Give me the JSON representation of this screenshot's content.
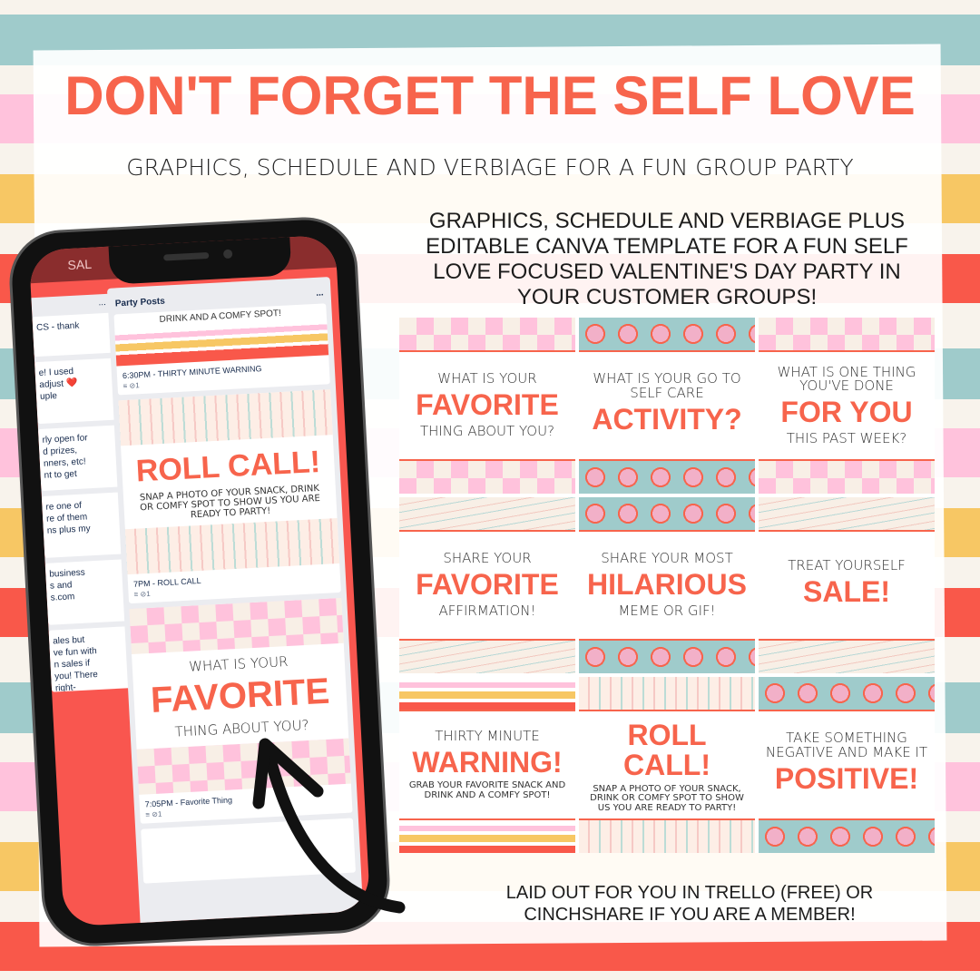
{
  "title": "DON'T FORGET THE SELF LOVE",
  "subtitle": "GRAPHICS, SCHEDULE AND VERBIAGE FOR A FUN GROUP PARTY",
  "description": [
    "GRAPHICS, SCHEDULE AND VERBIAGE PLUS",
    "EDITABLE CANVA TEMPLATE FOR A FUN SELF",
    "LOVE FOCUSED VALENTINE'S DAY PARTY IN",
    "YOUR CUSTOMER GROUPS!"
  ],
  "footer": [
    "LAID OUT FOR YOU IN TRELLO (FREE) OR",
    "CINCHSHARE IF YOU ARE A MEMBER!"
  ],
  "colors": {
    "accent": "#f7644c",
    "teal": "#9fcbcb",
    "pink": "#ffc2dc",
    "yellow": "#f7c764",
    "red": "#f9584a",
    "cream": "#f8f3ec"
  },
  "tiles": [
    {
      "pattern": "lips",
      "top": "WHAT IS YOUR",
      "big": "FAVORITE",
      "bottom": "THING ABOUT YOU?"
    },
    {
      "pattern": "hearts",
      "top": "WHAT IS YOUR GO TO SELF CARE",
      "big": "ACTIVITY?",
      "bottom": ""
    },
    {
      "pattern": "lips",
      "top": "WHAT IS ONE THING YOU'VE DONE",
      "big": "FOR YOU",
      "bottom": "THIS PAST WEEK?"
    },
    {
      "pattern": "iam",
      "top": "SHARE YOUR",
      "big": "FAVORITE",
      "bottom": "AFFIRMATION!"
    },
    {
      "pattern": "hearts",
      "top": "SHARE YOUR MOST",
      "big": "HILARIOUS",
      "bottom": "MEME OR GIF!"
    },
    {
      "pattern": "iam",
      "top": "TREAT YOURSELF",
      "big": "SALE!",
      "bottom": ""
    },
    {
      "pattern": "stripes",
      "top": "thirty minute",
      "big": "WARNING!",
      "bottom": "GRAB YOUR FAVORITE SNACK AND DRINK AND A COMFY SPOT!"
    },
    {
      "pattern": "xoxo",
      "top": "",
      "big": "ROLL CALL!",
      "bottom": "SNAP A PHOTO OF YOUR SNACK, DRINK OR COMFY SPOT TO SHOW US YOU ARE READY TO PARTY!"
    },
    {
      "pattern": "hearts",
      "top": "TAKE SOMETHING NEGATIVE AND MAKE IT",
      "big": "POSITIVE!",
      "bottom": ""
    }
  ],
  "phone": {
    "board_title": "SAL",
    "left_cards": [
      "CS - thank",
      "e! I used\nadjust ❤️\nuple",
      "rly open for\nd prizes,\nnners, etc!\nnt to get",
      "re one of\nre of them\nns plus my",
      "business\ns and\ns.com",
      "ales but\nve fun with\nn sales if\nyou! There\nright-"
    ],
    "list_title": "Party Posts",
    "menu": "...",
    "cards": [
      {
        "text": "DRINK AND A COMFY SPOT!",
        "label": "6:30PM - THIRTY MINUTE WARNING",
        "attachments": "1"
      },
      {
        "big": "ROLL CALL!",
        "text": "SNAP A PHOTO OF YOUR SNACK, DRINK OR COMFY SPOT TO SHOW US YOU ARE READY TO PARTY!",
        "label": "7PM - ROLL CALL",
        "attachments": "1"
      },
      {
        "top": "WHAT IS YOUR",
        "big": "FAVORITE",
        "text": "THING ABOUT YOU?",
        "label": "7:05PM - Favorite Thing",
        "attachments": "1"
      }
    ]
  }
}
